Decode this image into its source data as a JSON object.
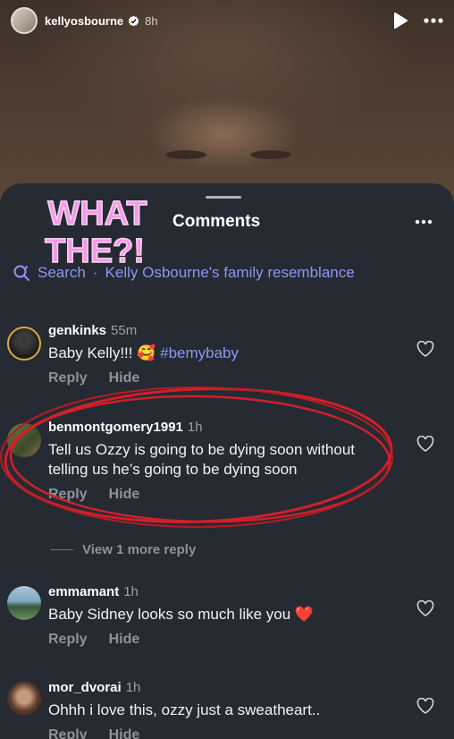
{
  "story": {
    "username": "kellyosbourne",
    "time": "8h"
  },
  "sheet": {
    "sticker_line1": "WHAT",
    "sticker_line2": "THE?!",
    "title": "Comments",
    "search_label": "Search",
    "search_separator": "·",
    "search_query": "Kelly Osbourne's family resemblance"
  },
  "comments": [
    {
      "username": "genkinks",
      "time": "55m",
      "text": "Baby Kelly!!! 🥰",
      "hashtag": "#bemybaby",
      "reply": "Reply",
      "hide": "Hide"
    },
    {
      "username": "benmontgomery1991",
      "time": "1h",
      "text": "Tell us Ozzy is going to be dying soon without telling us he’s going to be dying soon",
      "reply": "Reply",
      "hide": "Hide"
    },
    {
      "username": "emmamant",
      "time": "1h",
      "text": "Baby Sidney looks so much like you ❤️",
      "reply": "Reply",
      "hide": "Hide"
    },
    {
      "username": "mor_dvorai",
      "time": "1h",
      "text": "Ohhh i love this, ozzy just a sweatheart..",
      "reply": "Reply",
      "hide": "Hide"
    }
  ],
  "view_more_replies": "View 1 more reply",
  "colors": {
    "sheet_bg": "#262a33",
    "link": "#8c96f7",
    "muted": "#8e939b",
    "sticker_pink": "#f29ae6",
    "scribble_red": "#d0202a"
  }
}
